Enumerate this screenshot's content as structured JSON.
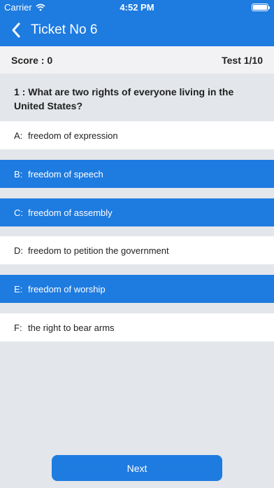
{
  "status_bar": {
    "carrier": "Carrier",
    "time": "4:52 PM"
  },
  "header": {
    "title": "Ticket No 6"
  },
  "score_bar": {
    "score": "Score : 0",
    "test": "Test 1/10"
  },
  "question": {
    "text": "1 : What are two rights of everyone living in the United States?"
  },
  "options": [
    {
      "letter": "A:",
      "text": "freedom of expression",
      "selected": false
    },
    {
      "letter": "B:",
      "text": "freedom of speech",
      "selected": true
    },
    {
      "letter": "C:",
      "text": "freedom of assembly",
      "selected": true
    },
    {
      "letter": "D:",
      "text": "freedom to petition the government",
      "selected": false
    },
    {
      "letter": "E:",
      "text": "freedom of worship",
      "selected": true
    },
    {
      "letter": "F:",
      "text": "the right to bear arms",
      "selected": false
    }
  ],
  "footer": {
    "next_label": "Next"
  },
  "colors": {
    "accent": "#1e7be0",
    "background": "#e3e6ea"
  }
}
